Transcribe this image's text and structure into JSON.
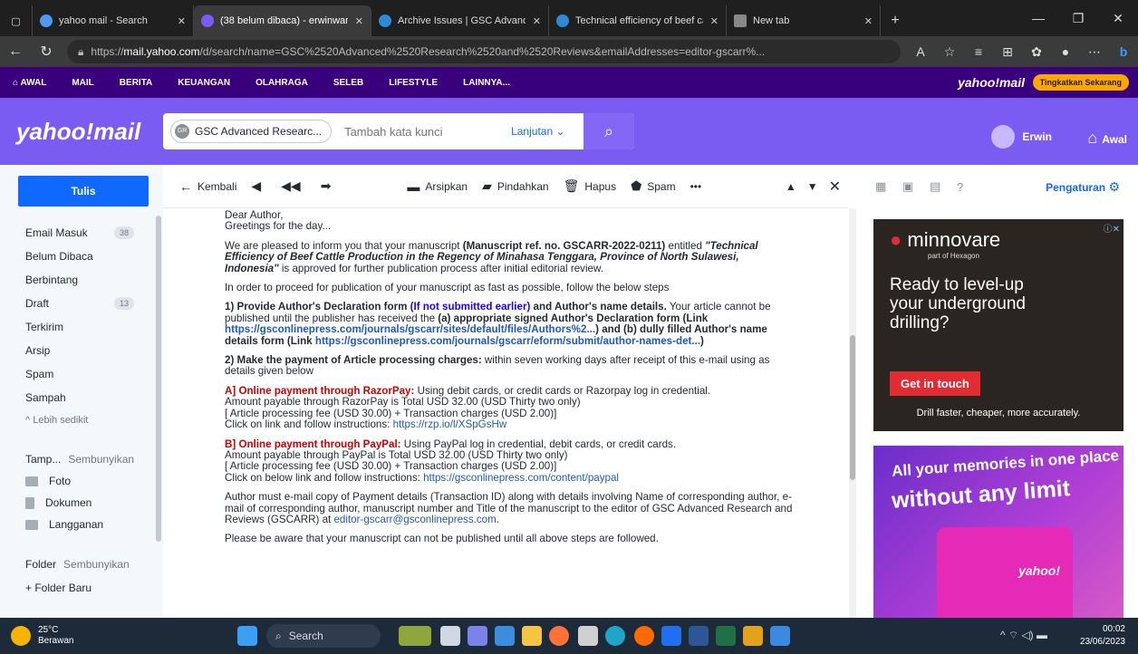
{
  "browser": {
    "tabs": [
      {
        "title": "yahoo mail - Search",
        "color": "#4e9af1"
      },
      {
        "title": "(38 belum dibaca) - erwinwan",
        "color": "#7b5cf3"
      },
      {
        "title": "Archive Issues | GSC Advance",
        "color": "#2c8ad6"
      },
      {
        "title": "Technical efficiency of beef ca",
        "color": "#2c8ad6"
      },
      {
        "title": "New tab",
        "color": "#888888"
      }
    ],
    "url_prefix": "https://",
    "url_domain": "mail.yahoo.com",
    "url_rest": "/d/search/name=GSC%2520Advanced%2520Research%2520and%2520Reviews&emailAddresses=editor-gscarr%..."
  },
  "yahoo_nav": {
    "items": [
      "AWAL",
      "MAIL",
      "BERITA",
      "KEUANGAN",
      "OLAHRAGA",
      "SELEB",
      "LIFESTYLE",
      "LAINNYA..."
    ],
    "brand": "yahoo!mail",
    "upgrade": "Tingkatkan Sekarang"
  },
  "header": {
    "logo": "yahoo!mail",
    "search_pill": "GSC Advanced Researc...",
    "search_pill_avatar": "GR",
    "keyword_placeholder": "Tambah kata kunci",
    "advanced": "Lanjutan ⌄",
    "user": "Erwin",
    "home": "Awal"
  },
  "sidebar": {
    "compose": "Tulis",
    "folders": [
      {
        "label": "Email Masuk",
        "count": "38"
      },
      {
        "label": "Belum Dibaca",
        "count": ""
      },
      {
        "label": "Berbintang",
        "count": ""
      },
      {
        "label": "Draft",
        "count": "13"
      },
      {
        "label": "Terkirim",
        "count": ""
      },
      {
        "label": "Arsip",
        "count": ""
      },
      {
        "label": "Spam",
        "count": ""
      },
      {
        "label": "Sampah",
        "count": ""
      }
    ],
    "less": "^ Lebih sedikit",
    "views_label": "Tamp...",
    "views_hide": "Sembunyikan",
    "views": [
      "Foto",
      "Dokumen",
      "Langganan"
    ],
    "folder_label": "Folder",
    "folder_hide": "Sembunyikan",
    "new_folder": "+ Folder Baru"
  },
  "toolbar": {
    "back": "Kembali",
    "archive": "Arsipkan",
    "move": "Pindahkan",
    "delete": "Hapus",
    "spam": "Spam"
  },
  "email": {
    "salutation": "Dear Author,",
    "greeting": "Greetings for the day...",
    "p1_a": "We are pleased to inform you that your manuscript ",
    "p1_b": "(Manuscript ref. no. GSCARR-2022-0211)",
    "p1_c": " entitled ",
    "p1_d": "\"Technical Efficiency of Beef Cattle Production in the Regency of Minahasa Tenggara, Province of North Sulawesi, Indonesia\"",
    "p1_e": " is approved for further publication process after initial editorial review.",
    "p2": "In order to proceed for publication of your manuscript as fast as possible, follow the below steps",
    "s1_a": "1) Provide Author's Declaration form ",
    "s1_b": "(If not submitted earlier)",
    "s1_c": " and Author's name details.",
    "s1_d": " Your article cannot be published until the publisher has received the ",
    "s1_e": "(a) appropriate signed Author's Declaration form (Link ",
    "s1_link1": "https://gsconlinepress.com/journals/gscarr/sites/default/files/Authors%2...",
    "s1_f": ") and (b) dully filled Author's name details form (Link ",
    "s1_link2": "https://gsconlinepress.com/journals/gscarr/eform/submit/author-names-det...",
    "s1_g": ")",
    "s2_a": "2) Make the payment of Article processing charges:",
    "s2_b": " within seven working days after receipt of this e-mail using as details given below",
    "ra_a": "A] Online payment through RazorPay:",
    "ra_b": " Using debit cards, or credit cards or Razorpay log in credential.",
    "ra_l1": "Amount payable through RazorPay is Total USD 32.00 (USD Thirty two only)",
    "ra_l2": "[ Article processing fee (USD 30.00) + Transaction charges (USD 2.00)]",
    "ra_l3": "Click on link and follow instructions: ",
    "ra_link": "https://rzp.io/l/XSpGsHw",
    "pp_a": "B] Online payment through PayPal:",
    "pp_b": " Using PayPal log in credential, debit cards, or credit cards.",
    "pp_l1": "Amount payable through PayPal is Total USD 32.00 (USD Thirty two only)",
    "pp_l2": "[ Article processing fee (USD 30.00) + Transaction charges (USD 2.00)]",
    "pp_l3": "Click on below link and follow instructions: ",
    "pp_link": "https://gsconlinepress.com/content/paypal",
    "p3_a": "Author must e-mail copy of Payment details (Transaction ID) along with details involving Name of corresponding author, e-mail of corresponding author, manuscript number and Title of the manuscript to the editor of GSC Advanced Research and Reviews (GSCARR) at ",
    "p3_link": "editor-gscarr@gsconlinepress.com",
    "p3_b": ".",
    "p4": "Please be aware that your manuscript can not be published until all above steps are followed."
  },
  "right_panel": {
    "settings": "Pengaturan",
    "ad1": {
      "brand": "minnovare",
      "sub": "part of Hexagon",
      "headline": "Ready to level-up your underground drilling?",
      "cta": "Get in touch",
      "footer": "Drill faster, cheaper, more accurately."
    },
    "ad2": {
      "line1": "All your memories in one place",
      "line2": "without any limit",
      "mailbox_brand": "yahoo!"
    }
  },
  "taskbar": {
    "temp": "25°C",
    "weather": "Berawan",
    "search": "Search",
    "time": "00:02",
    "date": "23/06/2023"
  }
}
